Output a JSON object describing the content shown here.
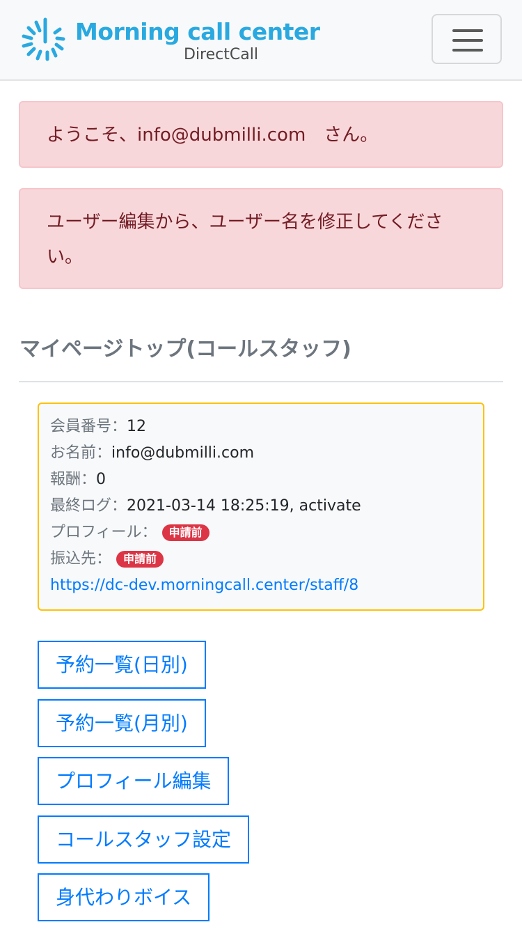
{
  "header": {
    "brand_title": "Morning call center",
    "brand_subtitle": "DirectCall",
    "logo_icon": "sunburst-icon",
    "menu_icon": "hamburger-icon",
    "brand_color": "#29a9e0"
  },
  "alerts": [
    "ようこそ、info@dubmilli.com　さん。",
    "ユーザー編集から、ユーザー名を修正してください。"
  ],
  "page_title": "マイページトップ(コールスタッフ)",
  "info": {
    "member_no_label": "会員番号：",
    "member_no": "12",
    "name_label": "お名前：",
    "name": "info@dubmilli.com",
    "reward_label": "報酬：",
    "reward": "0",
    "last_log_label": "最終ログ：",
    "last_log": "2021-03-14 18:25:19, activate",
    "profile_label": "プロフィール：",
    "profile_status": "申請前",
    "bank_label": "振込先：",
    "bank_status": "申請前",
    "staff_url": "https://dc-dev.morningcall.center/staff/8"
  },
  "buttons": [
    "予約一覧(日別)",
    "予約一覧(月別)",
    "プロフィール編集",
    "コールスタッフ設定",
    "身代わりボイス"
  ]
}
